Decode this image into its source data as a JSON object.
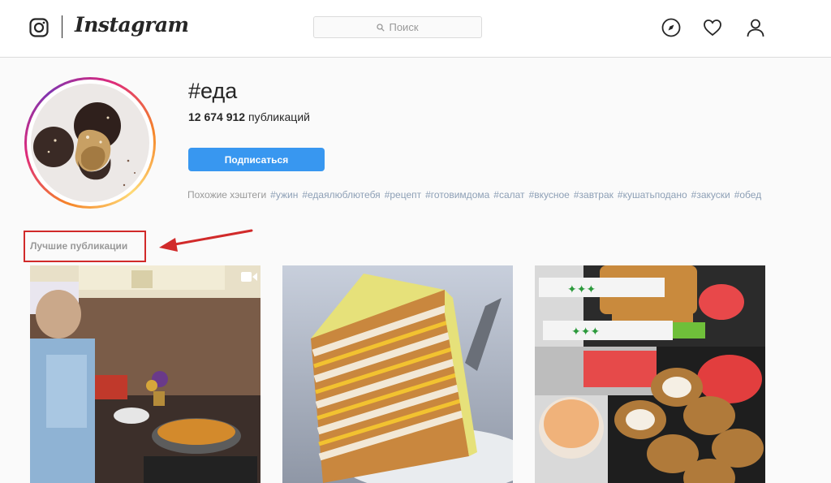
{
  "header": {
    "logo_text": "Instagram",
    "search_placeholder": "Поиск",
    "icons": [
      "instagram-glyph-icon",
      "search-icon",
      "explore-compass-icon",
      "heart-icon",
      "profile-icon"
    ]
  },
  "hashtag": {
    "title": "#еда",
    "post_count": "12 674 912",
    "post_count_suffix": "публикаций",
    "follow_label": "Подписаться"
  },
  "related": {
    "label": "Похожие хэштеги",
    "tags": [
      "#ужин",
      "#едаялюблютебя",
      "#рецепт",
      "#готовимдома",
      "#салат",
      "#вкусное",
      "#завтрак",
      "#кушатьподано",
      "#закуски",
      "#обед"
    ]
  },
  "top_posts": {
    "label": "Лучшие публикации"
  },
  "colors": {
    "accent_blue": "#3897f0",
    "annotation_red": "#d12a2a",
    "hashtag_link": "#8ea0b6"
  }
}
